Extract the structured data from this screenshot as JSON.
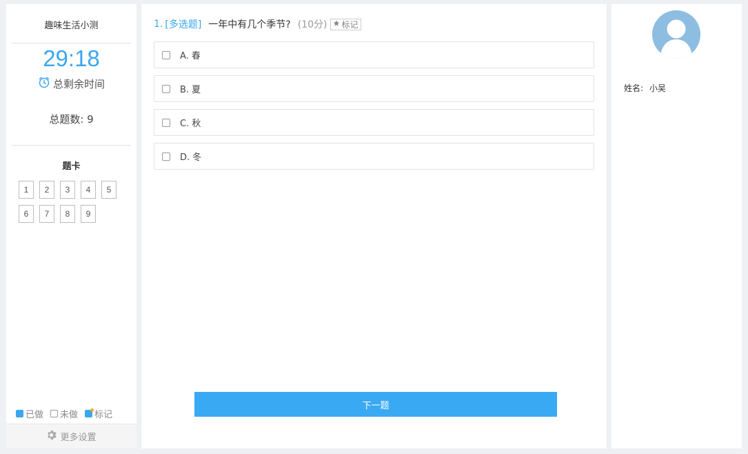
{
  "left": {
    "quiz_title": "趣味生活小测",
    "timer": "29:18",
    "remaining_label": "总剩余时间",
    "total_label": "总题数: 9",
    "card_title": "题卡",
    "question_numbers": [
      "1",
      "2",
      "3",
      "4",
      "5",
      "6",
      "7",
      "8",
      "9"
    ],
    "legend": {
      "done": "已做",
      "undone": "未做",
      "marked": "标记"
    },
    "settings_label": "更多设置"
  },
  "question": {
    "number": "1.",
    "type": "[多选题]",
    "text": "一年中有几个季节?",
    "score": "(10分)",
    "mark_label": "标记",
    "options": [
      "A. 春",
      "B. 夏",
      "C. 秋",
      "D. 冬"
    ]
  },
  "next_button": "下一题",
  "user": {
    "name_label": "姓名:",
    "name": "小吴"
  },
  "colors": {
    "accent": "#3aa6f0",
    "avatar": "#8dbde0"
  }
}
